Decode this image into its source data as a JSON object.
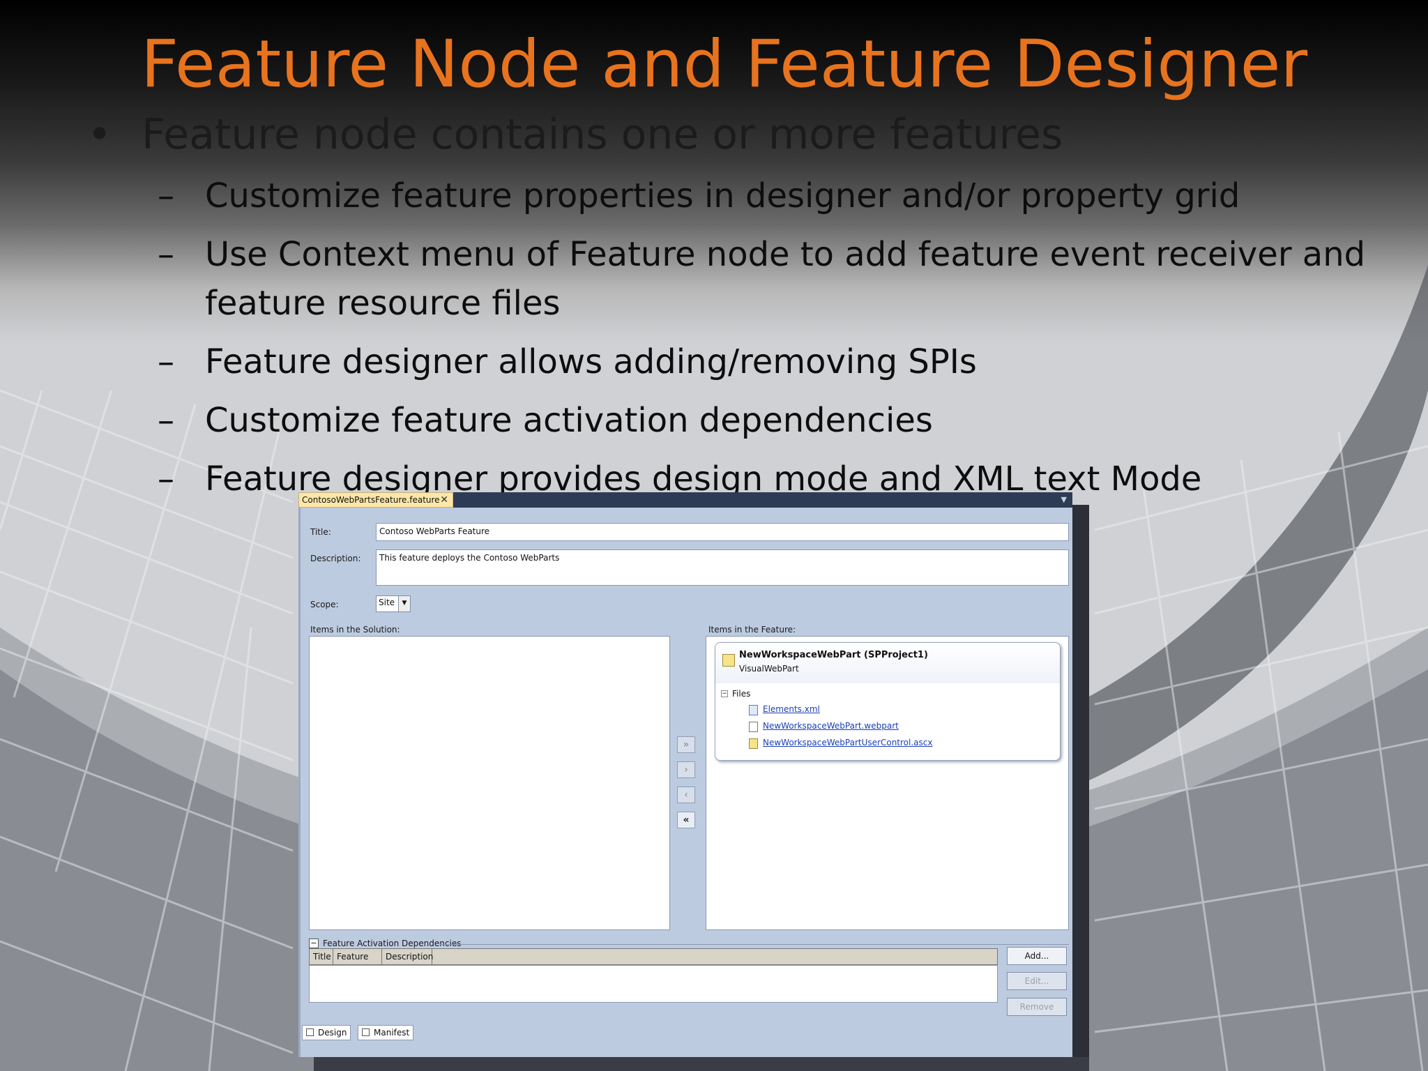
{
  "slide": {
    "title": "Feature Node and Feature Designer",
    "bullet_main": "Feature node contains one or more features",
    "bullet_symbol": "•",
    "dash_symbol": "–",
    "sub_bullets": [
      "Customize feature properties in designer and/or property grid",
      "Use Context menu of Feature node to add feature event receiver and",
      "feature resource files",
      "Feature designer allows adding/removing SPIs",
      "Customize feature activation dependencies",
      "Feature designer provides design mode and XML text Mode"
    ]
  },
  "designer": {
    "tab_title": "ContosoWebPartsFeature.feature",
    "tab_close": "✕",
    "title_label": "Title:",
    "title_value": "Contoso WebParts Feature",
    "description_label": "Description:",
    "description_value": "This feature deploys the Contoso WebParts",
    "scope_label": "Scope:",
    "scope_value": "Site",
    "solution_items_label": "Items in the Solution:",
    "feature_items_label": "Items in the Feature:",
    "move_buttons": [
      "»",
      "›",
      "‹",
      "«"
    ],
    "feature_item": {
      "name": "NewWorkspaceWebPart (SPProject1)",
      "type": "VisualWebPart",
      "files_label": "Files",
      "files": [
        "Elements.xml",
        "NewWorkspaceWebPart.webpart",
        "NewWorkspaceWebPartUserControl.ascx"
      ]
    },
    "dependencies_label": "Feature Activation Dependencies",
    "grid_columns": [
      "Title",
      "Feature ID",
      "Description"
    ],
    "buttons": {
      "add": "Add...",
      "edit": "Edit...",
      "remove": "Remove"
    },
    "bottom_tabs": [
      "Design",
      "Manifest"
    ]
  },
  "colors": {
    "title": "#e8731e",
    "link": "#1a3fb8",
    "designer_bg": "#bdcbe0"
  }
}
